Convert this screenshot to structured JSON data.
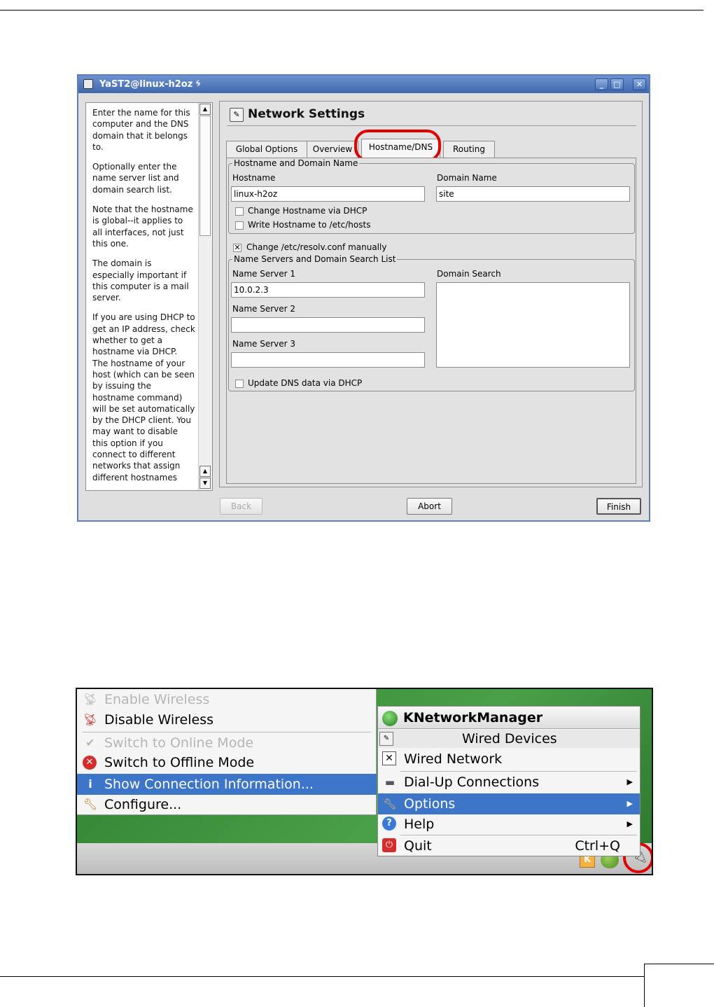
{
  "yast": {
    "window_title": "YaST2@linux-h2oz",
    "help_paragraphs": [
      "Enter the name for this computer and the DNS domain that it belongs to.",
      "Optionally enter the name server list and domain search list.",
      "Note that the hostname is global--it applies to all interfaces, not just this one.",
      "The domain is especially important if this computer is a mail server.",
      "If you are using DHCP to get an IP address, check whether to get a hostname via DHCP. The hostname of your host (which can be seen by issuing the hostname command) will be set automatically by the DHCP client. You may want to disable this option if you connect to different networks that assign different hostnames"
    ],
    "section_title": "Network Settings",
    "tabs": [
      "Global Options",
      "Overview",
      "Hostname/DNS",
      "Routing"
    ],
    "active_tab": "Hostname/DNS",
    "hostname_group": {
      "legend": "Hostname and Domain Name",
      "hostname_label": "Hostname",
      "hostname_value": "linux-h2oz",
      "domain_label": "Domain Name",
      "domain_value": "site",
      "change_hostname_dhcp": {
        "label": "Change Hostname via DHCP",
        "checked": false
      },
      "write_hostname_hosts": {
        "label": "Write Hostname to /etc/hosts",
        "checked": false
      }
    },
    "change_resolv": {
      "label": "Change /etc/resolv.conf manually",
      "checked": true
    },
    "nameserver_group": {
      "legend": "Name Servers and Domain Search List",
      "ns1_label": "Name Server 1",
      "ns1_value": "10.0.2.3",
      "ns2_label": "Name Server 2",
      "ns2_value": "",
      "ns3_label": "Name Server 3",
      "ns3_value": "",
      "domain_search_label": "Domain Search",
      "update_dns_dhcp": {
        "label": "Update DNS data via DHCP",
        "checked": false
      }
    },
    "buttons": {
      "back": "Back",
      "abort": "Abort",
      "finish": "Finish"
    }
  },
  "knm": {
    "context_menu": [
      {
        "label": "Enable Wireless",
        "icon": "wireless-antenna-icon",
        "disabled": true
      },
      {
        "label": "Disable Wireless",
        "icon": "wireless-antenna-icon",
        "disabled": false
      },
      {
        "label": "Switch to Online Mode",
        "icon": "checkmark-icon",
        "disabled": true
      },
      {
        "label": "Switch to Offline Mode",
        "icon": "red-x-icon",
        "disabled": false
      },
      {
        "label": "Show Connection Information...",
        "icon": "info-icon",
        "disabled": false,
        "selected": true
      },
      {
        "label": "Configure...",
        "icon": "wrench-icon",
        "disabled": false
      }
    ],
    "submenu": {
      "title": "KNetworkManager",
      "section": "Wired Devices",
      "items": [
        {
          "label": "Wired Network",
          "icon": "x-mark-icon"
        },
        {
          "label": "Dial-Up Connections",
          "icon": "modem-icon",
          "has_submenu": true
        },
        {
          "label": "Options",
          "icon": "wrench-icon",
          "has_submenu": true,
          "selected": true
        },
        {
          "label": "Help",
          "icon": "help-icon",
          "has_submenu": true
        },
        {
          "label": "Quit",
          "icon": "power-icon",
          "shortcut": "Ctrl+Q"
        }
      ]
    },
    "panel": {
      "k_label": "K"
    }
  }
}
